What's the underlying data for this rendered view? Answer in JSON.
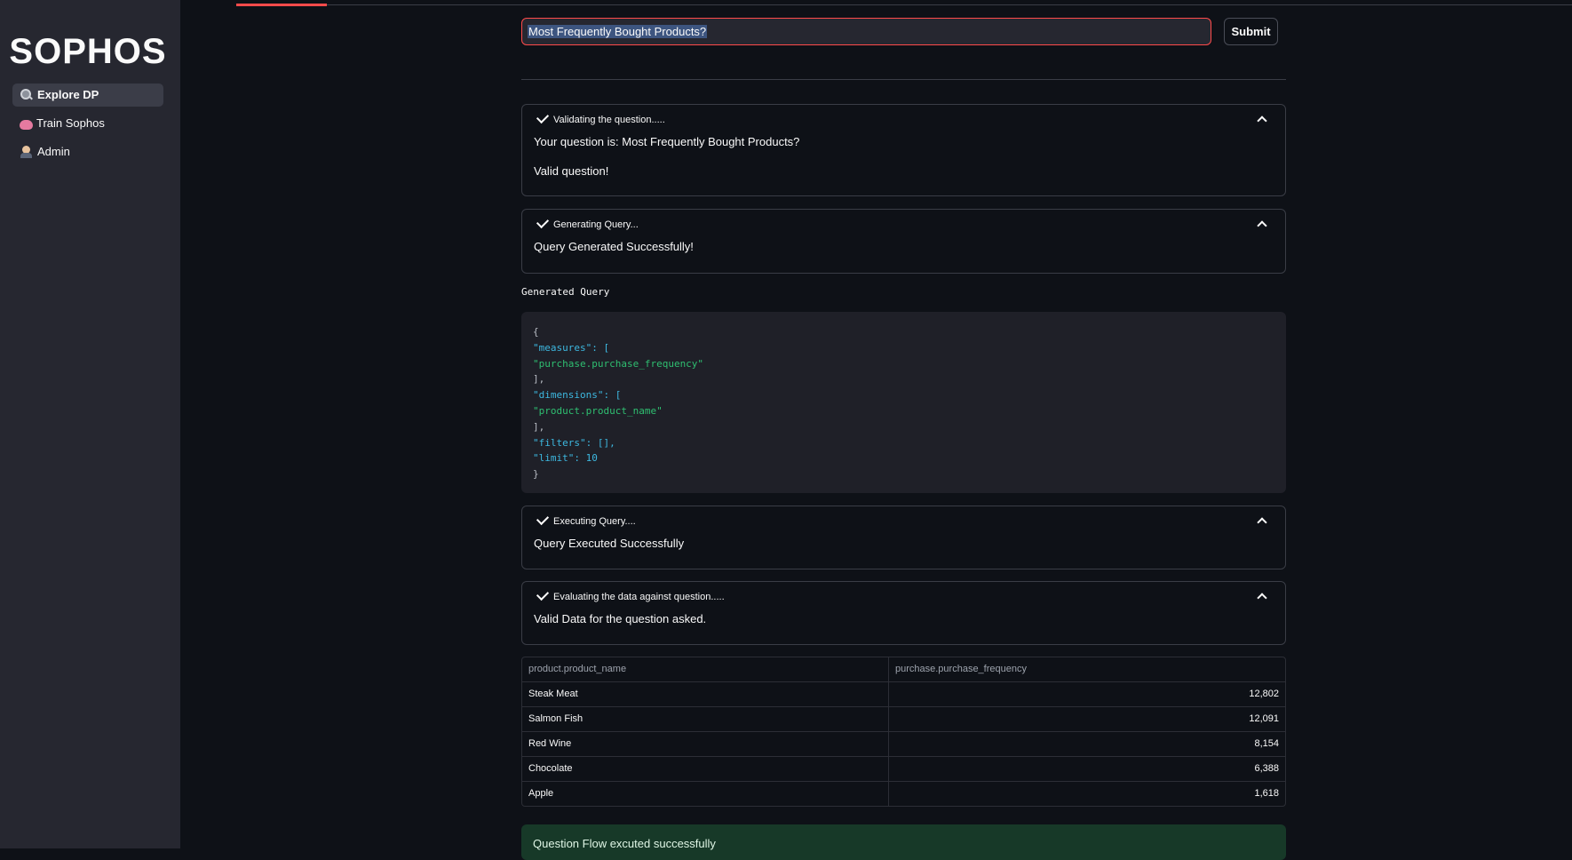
{
  "sidebar": {
    "brand": "SOPHOS",
    "items": [
      {
        "label": "Explore DP",
        "icon": "magnifier-icon",
        "active": true
      },
      {
        "label": "Train Sophos",
        "icon": "brain-icon",
        "active": false
      },
      {
        "label": "Admin",
        "icon": "admin-person-icon",
        "active": false
      }
    ]
  },
  "question": {
    "value": "Most Frequently Bought Products?",
    "submit_label": "Submit"
  },
  "steps": [
    {
      "title": "Validating the question.....",
      "lines": [
        "Your question is: Most Frequently Bought Products?",
        "Valid question!"
      ]
    },
    {
      "title": "Generating Query...",
      "lines": [
        "Query Generated Successfully!"
      ]
    },
    {
      "title": "Executing Query....",
      "lines": [
        "Query Executed Successfully"
      ]
    },
    {
      "title": "Evaluating the data against question.....",
      "lines": [
        "Valid Data for the question asked."
      ]
    }
  ],
  "generated_query": {
    "label": "Generated Query",
    "lines": [
      "{",
      "\"measures\": [",
      "\"purchase.purchase_frequency\"",
      "],",
      "\"dimensions\": [",
      "\"product.product_name\"",
      "],",
      "\"filters\": [],",
      "\"limit\": 10",
      "}"
    ]
  },
  "results": {
    "columns": [
      "product.product_name",
      "purchase.purchase_frequency"
    ],
    "rows": [
      [
        "Steak Meat",
        "12,802"
      ],
      [
        "Salmon Fish",
        "12,091"
      ],
      [
        "Red Wine",
        "8,154"
      ],
      [
        "Chocolate",
        "6,388"
      ],
      [
        "Apple",
        "1,618"
      ]
    ]
  },
  "success_message": "Question Flow excuted successfully",
  "colors": {
    "accent": "#ff4b4b",
    "background": "#0e1117",
    "sidebar": "#262730",
    "success_bg": "#173928"
  }
}
